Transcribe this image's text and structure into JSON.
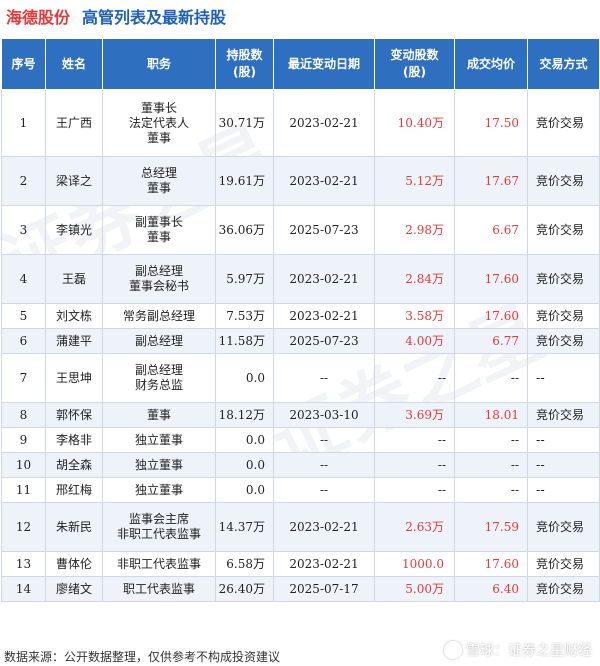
{
  "header": {
    "company": "海德股份",
    "title": "高管列表及最新持股"
  },
  "table": {
    "columns": [
      "序号",
      "姓名",
      "职务",
      "持股数\n(股)",
      "最近变动日期",
      "变动股数\n(股)",
      "成交均价",
      "交易方式"
    ],
    "rows": [
      {
        "no": "1",
        "name": "王广西",
        "roles": [
          "董事长",
          "法定代表人",
          "董事"
        ],
        "shares": "30.71万",
        "date": "2023-02-21",
        "change": "10.40万",
        "price": "17.50",
        "method": "竞价交易"
      },
      {
        "no": "2",
        "name": "梁译之",
        "roles": [
          "总经理",
          "董事"
        ],
        "shares": "19.61万",
        "date": "2023-02-21",
        "change": "5.12万",
        "price": "17.67",
        "method": "竞价交易"
      },
      {
        "no": "3",
        "name": "李镇光",
        "roles": [
          "副董事长",
          "董事"
        ],
        "shares": "36.06万",
        "date": "2025-07-23",
        "change": "2.98万",
        "price": "6.67",
        "method": "竞价交易"
      },
      {
        "no": "4",
        "name": "王磊",
        "roles": [
          "副总经理",
          "董事会秘书"
        ],
        "shares": "5.97万",
        "date": "2023-02-21",
        "change": "2.84万",
        "price": "17.60",
        "method": "竞价交易"
      },
      {
        "no": "5",
        "name": "刘文栋",
        "roles": [
          "常务副总经理"
        ],
        "shares": "7.53万",
        "date": "2023-02-21",
        "change": "3.58万",
        "price": "17.60",
        "method": "竞价交易"
      },
      {
        "no": "6",
        "name": "蒲建平",
        "roles": [
          "副总经理"
        ],
        "shares": "11.58万",
        "date": "2025-07-23",
        "change": "4.00万",
        "price": "6.77",
        "method": "竞价交易"
      },
      {
        "no": "7",
        "name": "王思坤",
        "roles": [
          "副总经理",
          "财务总监"
        ],
        "shares": "0.0",
        "date": "--",
        "change": "--",
        "price": "--",
        "method": "--"
      },
      {
        "no": "8",
        "name": "郭怀保",
        "roles": [
          "董事"
        ],
        "shares": "18.12万",
        "date": "2023-03-10",
        "change": "3.69万",
        "price": "18.01",
        "method": "竞价交易"
      },
      {
        "no": "9",
        "name": "李格非",
        "roles": [
          "独立董事"
        ],
        "shares": "0.0",
        "date": "--",
        "change": "--",
        "price": "--",
        "method": "--"
      },
      {
        "no": "10",
        "name": "胡全森",
        "roles": [
          "独立董事"
        ],
        "shares": "0.0",
        "date": "--",
        "change": "--",
        "price": "--",
        "method": "--"
      },
      {
        "no": "11",
        "name": "邢红梅",
        "roles": [
          "独立董事"
        ],
        "shares": "0.0",
        "date": "--",
        "change": "--",
        "price": "--",
        "method": "--"
      },
      {
        "no": "12",
        "name": "朱新民",
        "roles": [
          "监事会主席",
          "非职工代表监事"
        ],
        "shares": "14.37万",
        "date": "2023-02-21",
        "change": "2.63万",
        "price": "17.59",
        "method": "竞价交易"
      },
      {
        "no": "13",
        "name": "曹体伦",
        "roles": [
          "非职工代表监事"
        ],
        "shares": "6.58万",
        "date": "2023-02-21",
        "change": "1000.0",
        "price": "17.60",
        "method": "竞价交易"
      },
      {
        "no": "14",
        "name": "廖绪文",
        "roles": [
          "职工代表监事"
        ],
        "shares": "26.40万",
        "date": "2025-07-17",
        "change": "5.00万",
        "price": "6.40",
        "method": "竞价交易"
      }
    ]
  },
  "footer": {
    "source": "数据来源：公开数据整理，仅供参考不构成投资建议",
    "brand": "雪球：证券之星财经"
  },
  "watermark": "证券之星",
  "colors": {
    "header_bg": "#2f6fc0",
    "company": "#e5393a",
    "title": "#1f62b8",
    "accent_red": "#e5393a",
    "row_alt": "#eef3fa"
  }
}
